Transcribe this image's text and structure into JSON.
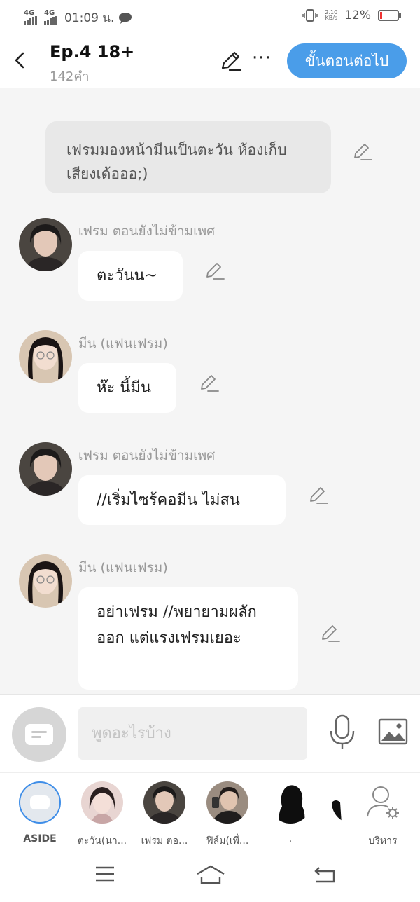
{
  "status_bar": {
    "network_1": "4G",
    "network_2": "4G",
    "time": "01:09 น.",
    "net_speed_value": "2.10",
    "net_speed_unit": "KB/s",
    "battery": "12%",
    "battery_level": 0.12
  },
  "header": {
    "title": "Ep.4 18+",
    "word_count": "142คำ",
    "next_button": "ขั้นตอนต่อไป"
  },
  "messages": [
    {
      "type": "narration",
      "text": "เฟรมมองหน้ามีนเป็นตะวัน ห้องเก็บเสียงเด้อออ;)"
    },
    {
      "type": "chat",
      "sender": "เฟรม ตอนยังไม่ข้ามเพศ",
      "text": "ตะวันน~"
    },
    {
      "type": "chat",
      "sender": "มีน (แฟนเฟรม)",
      "text": "ห๊ะ นี้มีน"
    },
    {
      "type": "chat",
      "sender": "เฟรม ตอนยังไม่ข้ามเพศ",
      "text": "//เริ่มไซร้คอมีน ไม่สน"
    },
    {
      "type": "chat",
      "sender": "มีน (แฟนเฟรม)",
      "text": "อย่าเฟรม //พยายามผลักออก แต่แรงเฟรมเยอะ"
    }
  ],
  "input": {
    "placeholder": "พูดอะไรบ้าง"
  },
  "characters": [
    {
      "label": "ASIDE"
    },
    {
      "label": "ตะวัน(นา..."
    },
    {
      "label": "เฟรม ตอ..."
    },
    {
      "label": "ฟิล์ม(เพื่..."
    },
    {
      "label": "."
    },
    {
      "label": "บริหาร"
    }
  ],
  "colors": {
    "accent": "#4a9de9",
    "chat_background": "#f5f5f5",
    "narration_bubble": "#e8e8e8"
  }
}
